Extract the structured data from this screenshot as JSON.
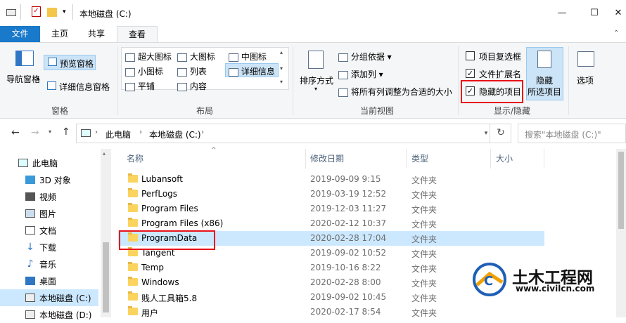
{
  "window": {
    "title": "本地磁盘 (C:)",
    "minimize": "—",
    "maximize": "☐",
    "close": "✕"
  },
  "tabs": [
    "文件",
    "主页",
    "共享",
    "查看"
  ],
  "ribbon": {
    "panes": {
      "nav_pane": "导航窗格",
      "preview_pane": "预览窗格",
      "details_pane": "详细信息窗格",
      "group": "窗格"
    },
    "layout": {
      "items": [
        "超大图标",
        "大图标",
        "中图标",
        "小图标",
        "列表",
        "详细信息",
        "平铺",
        "内容"
      ],
      "group": "布局"
    },
    "current_view": {
      "sort_by": "排序方式",
      "group_by": "分组依据",
      "add_columns": "添加列",
      "size_all_columns": "将所有列调整为合适的大小",
      "group": "当前视图"
    },
    "show_hide": {
      "item_checkboxes": "项目复选框",
      "file_extensions": "文件扩展名",
      "hidden_items": "隐藏的项目",
      "hide_selected_line1": "隐藏",
      "hide_selected_line2": "所选项目",
      "group": "显示/隐藏"
    },
    "options": "选项"
  },
  "address": {
    "crumbs": [
      "此电脑",
      "本地磁盘 (C:)"
    ],
    "search_placeholder": "搜索\"本地磁盘 (C:)\""
  },
  "sidebar": [
    "此电脑",
    "3D 对象",
    "视频",
    "图片",
    "文档",
    "下载",
    "音乐",
    "桌面",
    "本地磁盘 (C:)",
    "本地磁盘 (D:)"
  ],
  "columns": {
    "name": "名称",
    "date": "修改日期",
    "type": "类型",
    "size": "大小"
  },
  "files": [
    {
      "name": "Lubansoft",
      "date": "2019-09-09 9:15",
      "type": "文件夹"
    },
    {
      "name": "PerfLogs",
      "date": "2019-03-19 12:52",
      "type": "文件夹"
    },
    {
      "name": "Program Files",
      "date": "2019-12-03 11:27",
      "type": "文件夹"
    },
    {
      "name": "Program Files (x86)",
      "date": "2020-02-12 10:37",
      "type": "文件夹"
    },
    {
      "name": "ProgramData",
      "date": "2020-02-28 17:04",
      "type": "文件夹"
    },
    {
      "name": "Tangent",
      "date": "2019-09-02 10:52",
      "type": "文件夹"
    },
    {
      "name": "Temp",
      "date": "2019-10-16 8:22",
      "type": "文件夹"
    },
    {
      "name": "Windows",
      "date": "2020-02-28 8:00",
      "type": "文件夹"
    },
    {
      "name": "贱人工具箱5.8",
      "date": "2019-09-02 10:45",
      "type": "文件夹"
    },
    {
      "name": "用户",
      "date": "2020-02-17 8:54",
      "type": "文件夹"
    }
  ],
  "watermark": {
    "brand": "土木工程网",
    "url": "www.civilcn.com"
  },
  "colors": {
    "accent": "#1979ca",
    "selection": "#cce8ff",
    "highlight_box": "#e8131a"
  }
}
